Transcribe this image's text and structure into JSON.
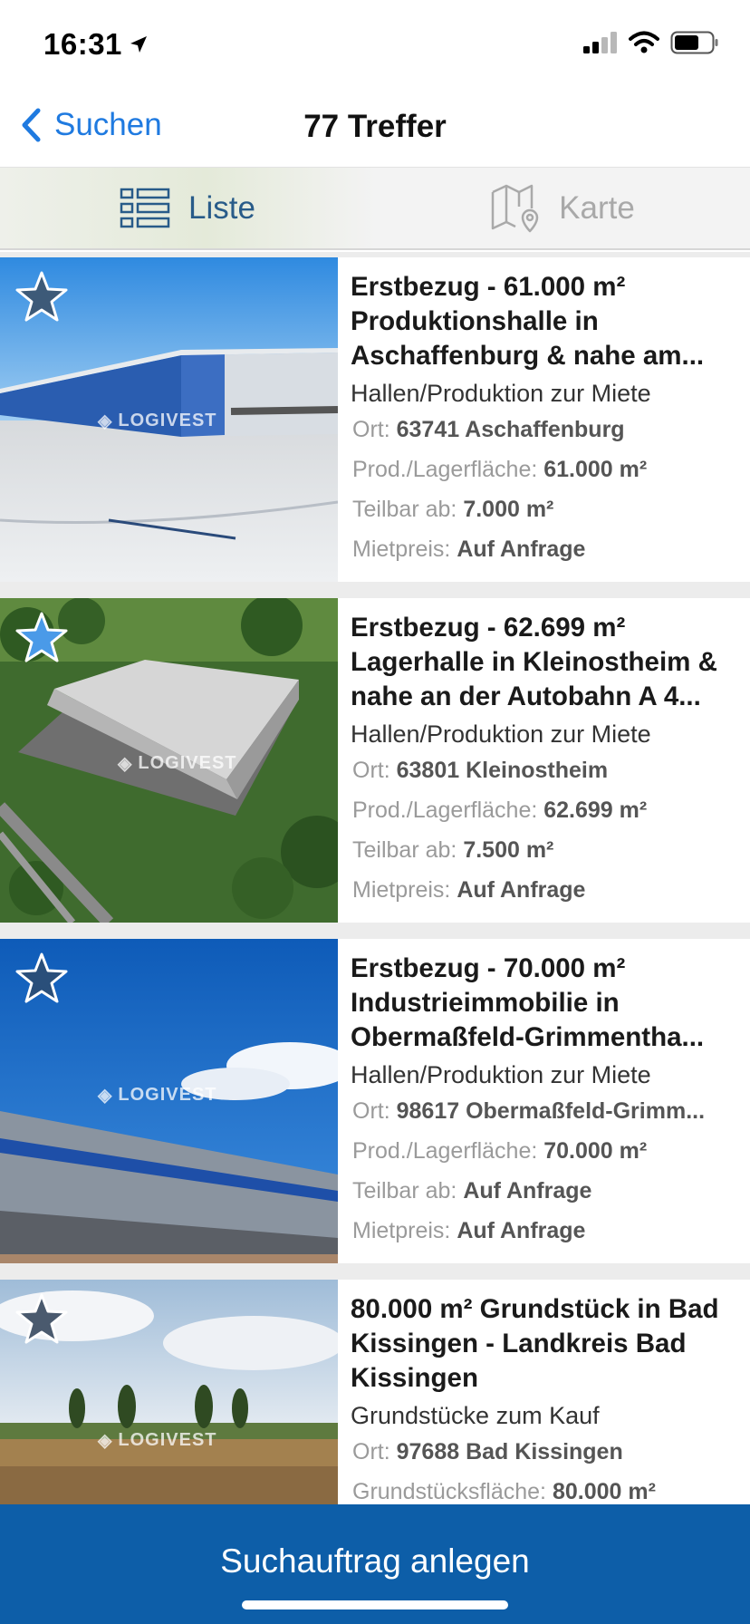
{
  "status": {
    "time": "16:31"
  },
  "nav": {
    "back_label": "Suchen",
    "title": "77 Treffer"
  },
  "tabs": [
    {
      "label": "Liste",
      "active": true
    },
    {
      "label": "Karte",
      "active": false
    }
  ],
  "listings": [
    {
      "title": "Erstbezug - 61.000 m² Produktionshalle in Aschaffenburg & nahe am...",
      "type": "Hallen/Produktion zur Miete",
      "rows": [
        {
          "label": "Ort:",
          "value": "63741 Aschaffenburg"
        },
        {
          "label": "Prod./Lagerfläche:",
          "value": "61.000 m²"
        },
        {
          "label": "Teilbar ab:",
          "value": "7.000 m²"
        },
        {
          "label": "Mietpreis:",
          "value": "Auf Anfrage"
        }
      ],
      "favorite": false,
      "watermark": "LOGIVEST"
    },
    {
      "title": "Erstbezug - 62.699 m² Lagerhalle in Kleinostheim & nahe an der Autobahn A 4...",
      "type": "Hallen/Produktion zur Miete",
      "rows": [
        {
          "label": "Ort:",
          "value": "63801 Kleinostheim"
        },
        {
          "label": "Prod./Lagerfläche:",
          "value": "62.699 m²"
        },
        {
          "label": "Teilbar ab:",
          "value": "7.500 m²"
        },
        {
          "label": "Mietpreis:",
          "value": "Auf Anfrage"
        }
      ],
      "favorite": true,
      "watermark": "LOGIVEST"
    },
    {
      "title": "Erstbezug - 70.000 m² Industrieimmobilie in Obermaßfeld-Grimmentha...",
      "type": "Hallen/Produktion zur Miete",
      "rows": [
        {
          "label": "Ort:",
          "value": "98617 Obermaßfeld-Grimm..."
        },
        {
          "label": "Prod./Lagerfläche:",
          "value": "70.000 m²"
        },
        {
          "label": "Teilbar ab:",
          "value": "Auf Anfrage"
        },
        {
          "label": "Mietpreis:",
          "value": "Auf Anfrage"
        }
      ],
      "favorite": false,
      "watermark": "LOGIVEST"
    },
    {
      "title": "80.000 m² Grundstück in Bad Kissingen - Landkreis Bad Kissingen",
      "type": "Grundstücke zum Kauf",
      "rows": [
        {
          "label": "Ort:",
          "value": "97688 Bad Kissingen"
        },
        {
          "label": "Grundstücksfläche:",
          "value": "80.000 m²"
        }
      ],
      "favorite": false,
      "watermark": "LOGIVEST"
    }
  ],
  "footer": {
    "button_label": "Suchauftrag anlegen"
  },
  "colors": {
    "accent": "#1f7ae0",
    "tab_active_text": "#285b89",
    "footer_bg": "#0d5ea8",
    "star_fav": "#4a9ae8",
    "star_default": "#3d5a78"
  }
}
